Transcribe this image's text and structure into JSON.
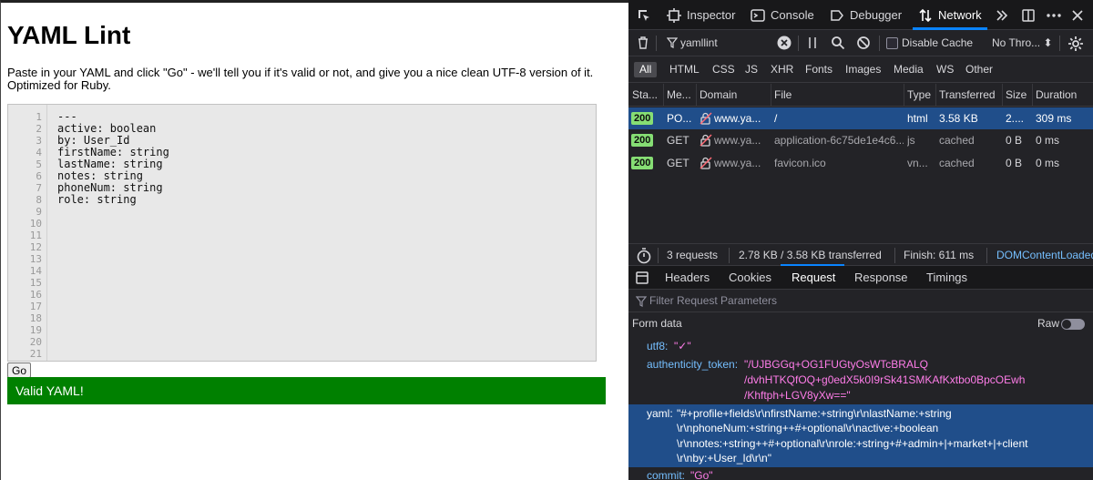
{
  "page": {
    "title": "YAML Lint",
    "description": "Paste in your YAML and click \"Go\" - we'll tell you if it's valid or not, and give you a nice clean UTF-8 version of it. Optimized for Ruby.",
    "line_numbers": [
      "1",
      "2",
      "3",
      "4",
      "5",
      "6",
      "7",
      "8",
      "9",
      "10",
      "11",
      "12",
      "13",
      "14",
      "15",
      "16",
      "17",
      "18",
      "19",
      "20",
      "21"
    ],
    "code_lines": [
      "---",
      "active: boolean",
      "by: User_Id",
      "firstName: string",
      "lastName: string",
      "notes: string",
      "phoneNum: string",
      "role: string"
    ],
    "go_label": "Go",
    "result_text": "Valid YAML!",
    "result_color": "#008000"
  },
  "devtools": {
    "tabs": {
      "inspector": "Inspector",
      "console": "Console",
      "debugger": "Debugger",
      "network": "Network"
    },
    "toolbar": {
      "filter_value": "yamllint",
      "disable_cache_label": "Disable Cache",
      "throttle_label": "No Thro... ⬍"
    },
    "type_filters": [
      "All",
      "HTML",
      "CSS",
      "JS",
      "XHR",
      "Fonts",
      "Images",
      "Media",
      "WS",
      "Other"
    ],
    "columns": [
      "Sta...",
      "Me...",
      "Domain",
      "File",
      "Type",
      "Transferred",
      "Size",
      "Duration"
    ],
    "requests": [
      {
        "status": "200",
        "method": "PO...",
        "domain": "www.ya...",
        "file": "/",
        "type": "html",
        "transferred": "3.58 KB",
        "size": "2....",
        "duration": "309 ms"
      },
      {
        "status": "200",
        "method": "GET",
        "domain": "www.ya...",
        "file": "application-6c75de1e4c6...",
        "type": "js",
        "transferred": "cached",
        "size": "0 B",
        "duration": "0 ms"
      },
      {
        "status": "200",
        "method": "GET",
        "domain": "www.ya...",
        "file": "favicon.ico",
        "type": "vn...",
        "transferred": "cached",
        "size": "0 B",
        "duration": "0 ms"
      }
    ],
    "summary": {
      "requests": "3 requests",
      "transferred": "2.78 KB / 3.58 KB transferred",
      "finish": "Finish: 611 ms",
      "dom": "DOMContentLoaded"
    },
    "detail_tabs": [
      "Headers",
      "Cookies",
      "Request",
      "Response",
      "Timings"
    ],
    "param_filter_placeholder": "Filter Request Parameters",
    "form_data_label": "Form data",
    "raw_label": "Raw",
    "params": {
      "utf8_key": "utf8:",
      "utf8_value": "\"✓\"",
      "token_key": "authenticity_token:",
      "token_lines": [
        "\"/UJBGGq+OG1FUGtyOsWTcBRALQ",
        "/dvhHTKQfOQ+g0edX5k0I9rSk41SMKAfKxtbo0BpcOEwh",
        "/Khftph+LGV8yXw==\""
      ],
      "yaml_key": "yaml:",
      "yaml_lines": [
        "\"#+profile+fields\\r\\nfirstName:+string\\r\\nlastName:+string",
        "\\r\\nphoneNum:+string++#+optional\\r\\nactive:+boolean",
        "\\r\\nnotes:+string++#+optional\\r\\nrole:+string+#+admin+|+market+|+client",
        "\\r\\nby:+User_Id\\r\\n\""
      ],
      "commit_key": "commit:",
      "commit_value": "\"Go\""
    }
  }
}
